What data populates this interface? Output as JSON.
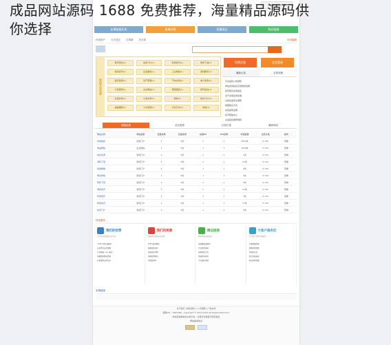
{
  "overlay": {
    "line1": "成品网站源码 1688 免费推荐，海量精品源码供",
    "line2": "你选择"
  },
  "header": {
    "site_button": "www.jocat.cn"
  },
  "top_tabs": [
    {
      "label": "友情链接买卖",
      "color": "#7fa9cf"
    },
    {
      "label": "旧域交易",
      "color": "#f2a03b"
    },
    {
      "label": "权重高品",
      "color": "#7fa9cf"
    },
    {
      "label": "购买链接",
      "color": "#4ebd6b"
    }
  ],
  "crumb": {
    "items": [
      "在线用户",
      "今日成交",
      "交易额",
      "总交易"
    ],
    "right": "在线客服"
  },
  "categories": {
    "side_label": "新链开张特惠",
    "items": [
      "教育培训(1)",
      "综合门户(1)",
      "影视音乐(1)",
      "软件下载(1)",
      "新闻资讯(1)",
      "生活服务(1)",
      "工业制造(1)",
      "游戏娱乐(1)",
      "医疗健康(1)",
      "房产家居(1)",
      "汽车交通(1)",
      "电子商务(1)",
      "IT互联网(1)",
      "企业网站(1)",
      "旅游酒店(1)",
      "体育运动(1)",
      "女性时尚(1)",
      "小说文学(1)",
      "其他(1)",
      "地方门户(1)",
      "金融理财(1)",
      "人才招聘(1)",
      "文化艺术(1)",
      "商贸(1)"
    ]
  },
  "side": {
    "btn1": "免费注册",
    "btn2": "会员登录",
    "tab1": "最新公告",
    "tab2": "交易流程",
    "notices": [
      "平台最新公告通知",
      "本站友情链接交易规则说明",
      "如何购买友情链接",
      "关于虚假交易处理",
      "交易资金安全保障",
      "客服联系方式",
      "充值提现说明",
      "新手帮助中心",
      "主站链接推荐规则"
    ]
  },
  "table": {
    "tabs": [
      "网站出售",
      "站长推荐",
      "交易记录",
      "最新网站"
    ],
    "headers": [
      "网站名称",
      "网站类型",
      "百度权重",
      "百度收录",
      "谷歌PR",
      "360权重",
      "外链数量",
      "出售价格",
      "操作"
    ],
    "rows": [
      [
        "友情链接",
        "综合门户",
        "1",
        "5条",
        "1",
        "1",
        "2620条",
        "¥ 100",
        "查看"
      ],
      [
        "成品网站",
        "企业网站",
        "1",
        "5条",
        "1",
        "1",
        "1000条",
        "¥ 120",
        "查看"
      ],
      [
        "站长资源",
        "新闻门户",
        "1",
        "5条",
        "1",
        "1",
        "1条",
        "¥ 120",
        "查看"
      ],
      [
        "源码下载",
        "新闻门户",
        "1",
        "5条",
        "1",
        "1",
        "21条",
        "¥ 120",
        "查看"
      ],
      [
        "建站教程",
        "新闻门户",
        "1",
        "5条",
        "1",
        "1",
        "6条",
        "¥ 120",
        "查看"
      ],
      [
        "网址导航",
        "新闻门户",
        "1",
        "5条",
        "1",
        "1",
        "5条",
        "¥ 120",
        "查看"
      ],
      [
        "软件下载",
        "新闻门户",
        "1",
        "5条",
        "1",
        "1",
        "5条",
        "¥ 120",
        "查看"
      ],
      [
        "游戏资讯",
        "新闻门户",
        "1",
        "5条",
        "1",
        "1",
        "21条",
        "¥ 120",
        "查看"
      ],
      [
        "影视音乐",
        "新闻门户",
        "1",
        "5条",
        "1",
        "1",
        "7条",
        "¥ 120",
        "查看"
      ],
      [
        "新闻资讯",
        "新闻门户",
        "1",
        "5条",
        "1",
        "1",
        "37条",
        "¥ 120",
        "查看"
      ],
      [
        "综合门户",
        "新闻门户",
        "1",
        "5条",
        "1",
        "1",
        "5条",
        "¥ 120",
        "查看"
      ]
    ]
  },
  "services": {
    "title": "特色服务",
    "cols": [
      {
        "title": "我们的优势",
        "color": "#3b7fc4",
        "desc": "专业的友情链接交易平台",
        "items": [
          "7x24小时在线服务",
          "交易资金安全保障",
          "专业客服一对一服务",
          "海量优质网站资源",
          "价格透明公开公正"
        ]
      },
      {
        "title": "我们的资源",
        "color": "#e0413a",
        "desc": "海量网站资源任你选择",
        "items": [
          "100%真实网站",
          "权重高收录好",
          "链接稳定可靠",
          "多种类型网站",
          "持续更新中"
        ]
      },
      {
        "title": "精品链接",
        "color": "#4ab04a",
        "desc": "精选优质友情链接",
        "items": [
          "高权重链接推荐",
          "行业相关链接",
          "长期稳定合作",
          "快速提升排名",
          "专业团队审核"
        ]
      },
      {
        "title": "大客户服务区",
        "color": "#3aa0c8",
        "desc": "为大客户提供专属服务",
        "items": [
          "专属客服经理",
          "批量采购优惠",
          "定制化方案",
          "优先审核通道",
          "售后无忧保障"
        ]
      }
    ]
  },
  "links": {
    "title": "友情链接"
  },
  "footer": {
    "nav": "关于我们 | 联系我们 | 人才招聘 | 广告合作",
    "line1": "客服QQ：7681408，Copyright © 2014-2015 All Rights Reserved.",
    "line2": "本站仅提供信息交易平台，交易双方需自行核实信息",
    "line3": "网站备案信息"
  }
}
